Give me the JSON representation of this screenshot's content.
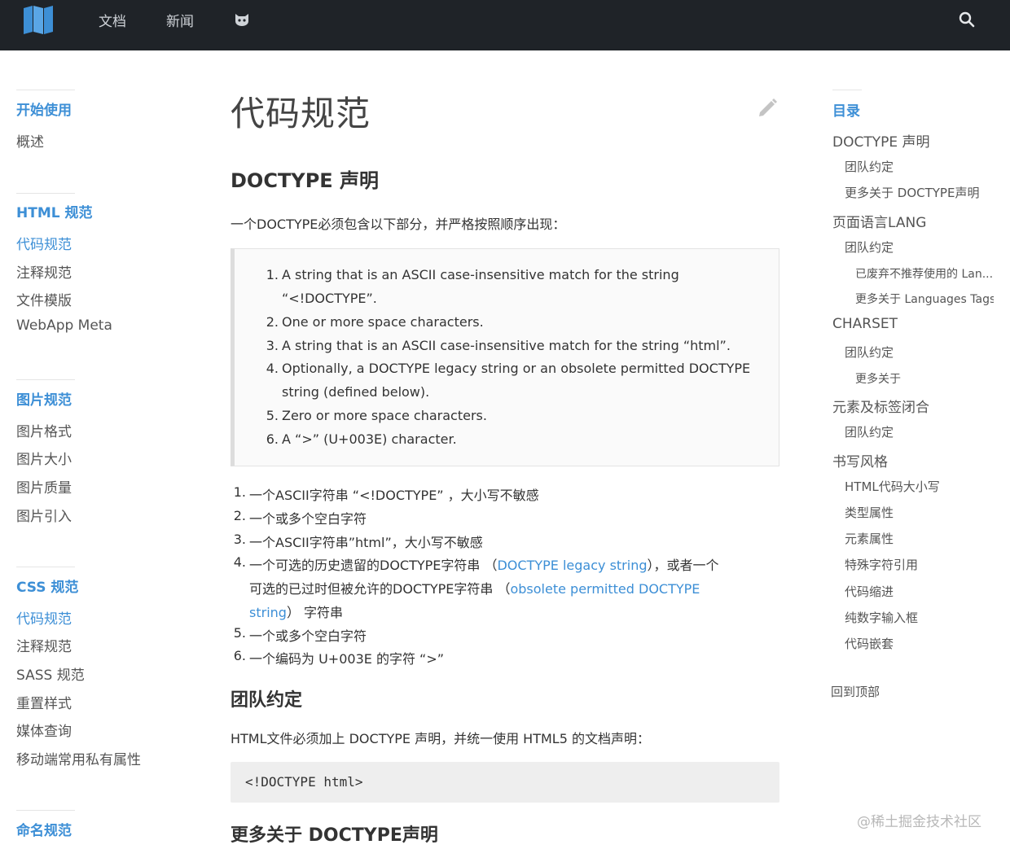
{
  "topnav": {
    "links": [
      "文档",
      "新闻"
    ],
    "icon": "github-cat-icon",
    "search_icon": "search-icon",
    "logo_icon": "book-logo-icon"
  },
  "sidebar": {
    "sections": [
      {
        "title": "开始使用",
        "items": [
          "概述"
        ]
      },
      {
        "title": "HTML 规范",
        "items": [
          "代码规范",
          "注释规范",
          "文件模版",
          "WebApp Meta"
        ]
      },
      {
        "title": "图片规范",
        "items": [
          "图片格式",
          "图片大小",
          "图片质量",
          "图片引入"
        ]
      },
      {
        "title": "CSS 规范",
        "items": [
          "代码规范",
          "注释规范",
          "SASS 规范",
          "重置样式",
          "媒体查询",
          "移动端常用私有属性"
        ]
      },
      {
        "title": "命名规范",
        "items": []
      }
    ]
  },
  "main": {
    "title": "代码规范",
    "h_doctype": "DOCTYPE 声明",
    "intro": "一个DOCTYPE必须包含以下部分，并严格按照顺序出现：",
    "quote_items": [
      {
        "num": "1.",
        "lines": [
          "A string that is an ASCII case-insensitive match for the string",
          "“<!DOCTYPE”."
        ]
      },
      {
        "num": "2.",
        "lines": [
          "One or more space characters."
        ]
      },
      {
        "num": "3.",
        "lines": [
          "A string that is an ASCII case-insensitive match for the string “html”."
        ]
      },
      {
        "num": "4.",
        "lines": [
          "Optionally, a DOCTYPE legacy string or an obsolete permitted DOCTYPE",
          "string (defined below)."
        ]
      },
      {
        "num": "5.",
        "lines": [
          "Zero or more space characters."
        ]
      },
      {
        "num": "6.",
        "lines": [
          "A “>” (U+003E) character."
        ]
      }
    ],
    "zh_items": {
      "n1": "1.",
      "t1": "一个ASCII字符串 “<!DOCTYPE” ，大小写不敏感",
      "n2": "2.",
      "t2": "一个或多个空白字符",
      "n3": "3.",
      "t3": "一个ASCII字符串”html”，大小写不敏感",
      "n4": "4.",
      "t4a": "一个可选的历史遗留的DOCTYPE字符串 （",
      "t4_link1": "DOCTYPE legacy string",
      "t4b": "），或者一个",
      "t4c": "可选的已过时但被允许的DOCTYPE字符串 （",
      "t4_link2a": "obsolete permitted DOCTYPE",
      "t4_link2b": "string",
      "t4d": "） 字符串",
      "n5": "5.",
      "t5": "一个或多个空白字符",
      "n6": "6.",
      "t6": "一个编码为 U+003E 的字符 “>”"
    },
    "h_team": "团队约定",
    "team_text": "HTML文件必须加上 DOCTYPE 声明，并统一使用 HTML5 的文档声明：",
    "code": "<!DOCTYPE html>",
    "h_more": "更多关于 DOCTYPE声明"
  },
  "toc": {
    "title": "目录",
    "items": [
      {
        "level": 1,
        "label": "DOCTYPE 声明"
      },
      {
        "level": 2,
        "label": "团队约定"
      },
      {
        "level": 2,
        "label": "更多关于 DOCTYPE声明"
      },
      {
        "level": 1,
        "label": "页面语言LANG"
      },
      {
        "level": 2,
        "label": "团队约定"
      },
      {
        "level": 3,
        "label": "已废弃不推荐使用的 Lan..."
      },
      {
        "level": 3,
        "label": "更多关于 Languages Tags..."
      },
      {
        "level": 1,
        "label": "CHARSET"
      },
      {
        "level": 2,
        "label": "团队约定"
      },
      {
        "level": 3,
        "label": "更多关于"
      },
      {
        "level": 1,
        "label": "元素及标签闭合"
      },
      {
        "level": 2,
        "label": "团队约定"
      },
      {
        "level": 1,
        "label": "书写风格"
      },
      {
        "level": 2,
        "label": "HTML代码大小写"
      },
      {
        "level": 2,
        "label": "类型属性"
      },
      {
        "level": 2,
        "label": "元素属性"
      },
      {
        "level": 2,
        "label": "特殊字符引用"
      },
      {
        "level": 2,
        "label": "代码缩进"
      },
      {
        "level": 2,
        "label": "纯数字输入框"
      },
      {
        "level": 2,
        "label": "代码嵌套"
      }
    ],
    "back_top": "回到顶部"
  },
  "watermark": "@稀土掘金技术社区",
  "colors": {
    "accent": "#3d8fd6",
    "topbar": "#1f2328"
  }
}
